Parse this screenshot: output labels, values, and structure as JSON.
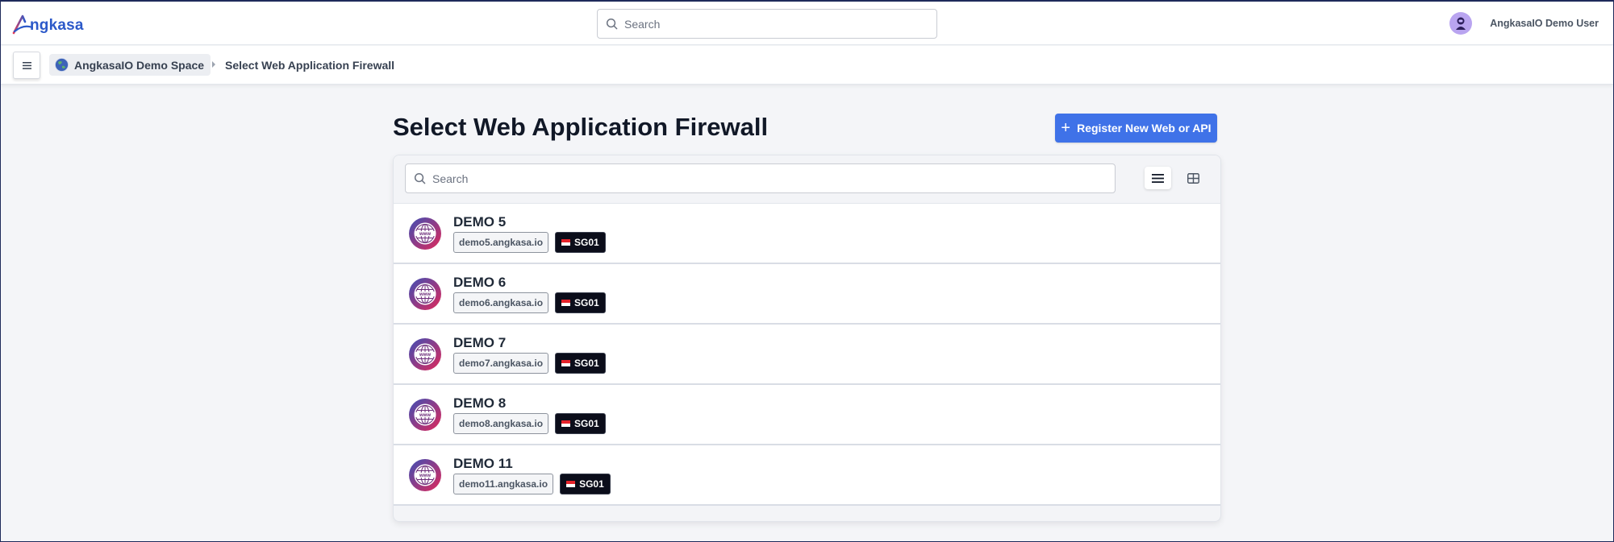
{
  "header": {
    "logo_text": "ngkasa",
    "search_placeholder": "Search",
    "user_name": "AngkasaIO Demo User"
  },
  "breadcrumb": {
    "space": "AngkasaIO Demo Space",
    "current": "Select Web Application Firewall"
  },
  "main": {
    "title": "Select Web Application Firewall",
    "register_label": "Register New Web or API",
    "search_placeholder": "Search",
    "view_mode": "list",
    "items": [
      {
        "name": "DEMO 5",
        "domain": "demo5.angkasa.io",
        "region": "SG01"
      },
      {
        "name": "DEMO 6",
        "domain": "demo6.angkasa.io",
        "region": "SG01"
      },
      {
        "name": "DEMO 7",
        "domain": "demo7.angkasa.io",
        "region": "SG01"
      },
      {
        "name": "DEMO 8",
        "domain": "demo8.angkasa.io",
        "region": "SG01"
      },
      {
        "name": "DEMO 11",
        "domain": "demo11.angkasa.io",
        "region": "SG01"
      }
    ]
  },
  "colors": {
    "accent": "#3f72e8",
    "logo": "#2c59c9",
    "region_badge": "#0b0d1a"
  },
  "icons": {
    "logo": "angkasa-logo-icon",
    "search": "search-icon",
    "menu": "hamburger-icon",
    "space": "globe-icon",
    "separator": "chevron-right-icon",
    "register": "plus-icon",
    "list_view": "list-view-icon",
    "grid_view": "grid-view-icon",
    "site": "www-globe-icon",
    "flag": "flag-icon"
  }
}
